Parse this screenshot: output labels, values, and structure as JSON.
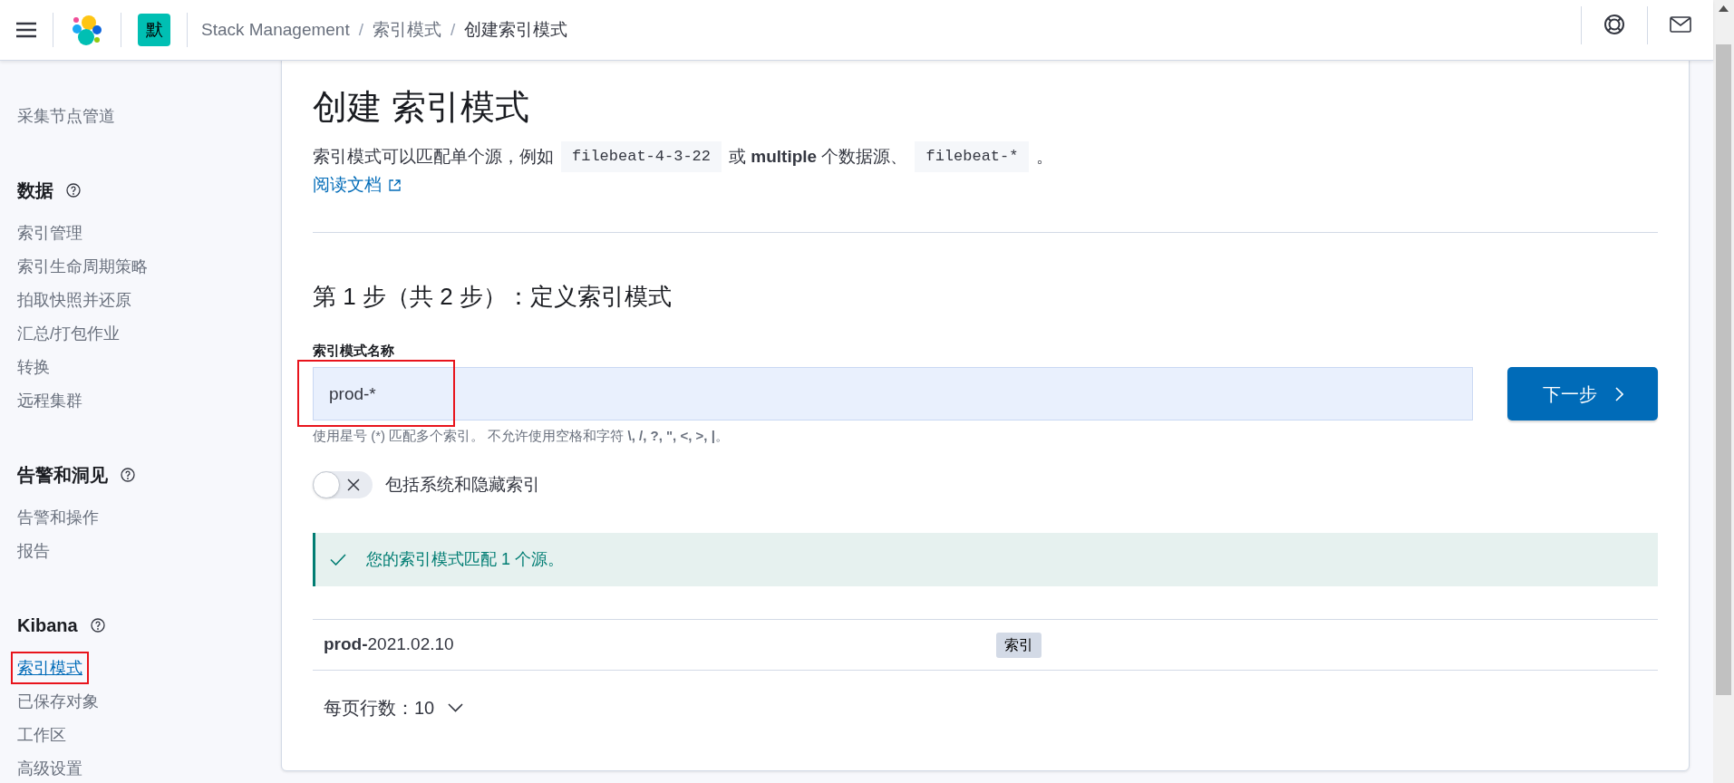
{
  "header": {
    "space_badge": "默",
    "separator": "/",
    "breadcrumbs": [
      {
        "label": "Stack Management",
        "current": false
      },
      {
        "label": "索引模式",
        "current": false
      },
      {
        "label": "创建索引模式",
        "current": true
      }
    ]
  },
  "sidebar": {
    "sections": [
      {
        "items": [
          {
            "label": "采集节点管道",
            "selected": false,
            "highlighted": false
          }
        ]
      },
      {
        "title": "数据",
        "items": [
          {
            "label": "索引管理",
            "selected": false,
            "highlighted": false
          },
          {
            "label": "索引生命周期策略",
            "selected": false,
            "highlighted": false
          },
          {
            "label": "拍取快照并还原",
            "selected": false,
            "highlighted": false
          },
          {
            "label": "汇总/打包作业",
            "selected": false,
            "highlighted": false
          },
          {
            "label": "转换",
            "selected": false,
            "highlighted": false
          },
          {
            "label": "远程集群",
            "selected": false,
            "highlighted": false
          }
        ]
      },
      {
        "title": "告警和洞见",
        "items": [
          {
            "label": "告警和操作",
            "selected": false,
            "highlighted": false
          },
          {
            "label": "报告",
            "selected": false,
            "highlighted": false
          }
        ]
      },
      {
        "title": "Kibana",
        "items": [
          {
            "label": "索引模式",
            "selected": true,
            "highlighted": true
          },
          {
            "label": "已保存对象",
            "selected": false,
            "highlighted": false
          },
          {
            "label": "工作区",
            "selected": false,
            "highlighted": false
          },
          {
            "label": "高级设置",
            "selected": false,
            "highlighted": false
          }
        ]
      }
    ]
  },
  "page": {
    "title": "创建 索引模式",
    "description": [
      {
        "kind": "text",
        "text": "索引模式可以匹配单个源，例如"
      },
      {
        "kind": "code",
        "text": "filebeat-4-3-22"
      },
      {
        "kind": "text",
        "text": "或 **multiple** 个数据源、"
      },
      {
        "kind": "code",
        "text": "filebeat-*"
      },
      {
        "kind": "text",
        "text": "。"
      }
    ],
    "docs_link": "阅读文档",
    "step_title": "第 1 步（共 2 步）：定义索引模式",
    "field": {
      "label": "索引模式名称",
      "value": "prod-*",
      "highlighted": true,
      "help": "使用星号 (*) 匹配多个索引。 不允许使用空格和字符 **\\, /, ?, \", <, >, |**。"
    },
    "next_button": "下一步",
    "toggle": {
      "label": "包括系统和隐藏索引",
      "on": false
    },
    "callout": "您的索引模式匹配 1 个源。",
    "rows": [
      {
        "name": "**prod-**2021.02.10",
        "tag": "索引"
      }
    ],
    "rows_per_page": "每页行数：10"
  }
}
